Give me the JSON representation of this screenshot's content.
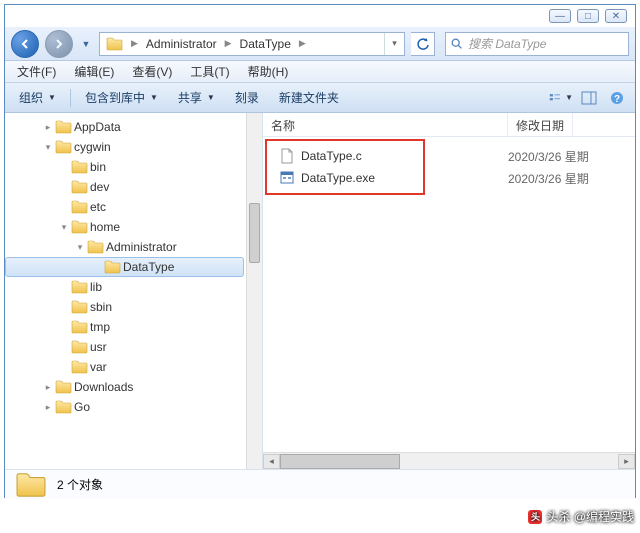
{
  "window_controls": {
    "min": "—",
    "max": "□",
    "close": "✕"
  },
  "nav": {
    "breadcrumb": [
      {
        "icon": "folder",
        "label": ""
      },
      {
        "label": "Administrator"
      },
      {
        "label": "DataType"
      }
    ]
  },
  "search": {
    "placeholder": "搜索 DataType"
  },
  "menubar": [
    {
      "label": "文件(F)"
    },
    {
      "label": "编辑(E)"
    },
    {
      "label": "查看(V)"
    },
    {
      "label": "工具(T)"
    },
    {
      "label": "帮助(H)"
    }
  ],
  "toolbar": {
    "organize": "组织",
    "include": "包含到库中",
    "share": "共享",
    "burn": "刻录",
    "newfolder": "新建文件夹"
  },
  "tree": [
    {
      "indent": 2,
      "tw": "▸",
      "label": "AppData"
    },
    {
      "indent": 2,
      "tw": "▾",
      "label": "cygwin"
    },
    {
      "indent": 3,
      "tw": "",
      "label": "bin"
    },
    {
      "indent": 3,
      "tw": "",
      "label": "dev"
    },
    {
      "indent": 3,
      "tw": "",
      "label": "etc"
    },
    {
      "indent": 3,
      "tw": "▾",
      "label": "home"
    },
    {
      "indent": 4,
      "tw": "▾",
      "label": "Administrator"
    },
    {
      "indent": 5,
      "tw": "",
      "label": "DataType",
      "selected": true
    },
    {
      "indent": 3,
      "tw": "",
      "label": "lib"
    },
    {
      "indent": 3,
      "tw": "",
      "label": "sbin"
    },
    {
      "indent": 3,
      "tw": "",
      "label": "tmp"
    },
    {
      "indent": 3,
      "tw": "",
      "label": "usr"
    },
    {
      "indent": 3,
      "tw": "",
      "label": "var"
    },
    {
      "indent": 2,
      "tw": "▸",
      "label": "Downloads"
    },
    {
      "indent": 2,
      "tw": "▸",
      "label": "Go"
    }
  ],
  "columns": {
    "name": "名称",
    "date": "修改日期"
  },
  "files": [
    {
      "icon": "file",
      "name": "DataType.c",
      "date": "2020/3/26 星期"
    },
    {
      "icon": "exe",
      "name": "DataType.exe",
      "date": "2020/3/26 星期"
    }
  ],
  "status": {
    "count": "2 个对象"
  },
  "watermark": "头杀 @编程实践"
}
